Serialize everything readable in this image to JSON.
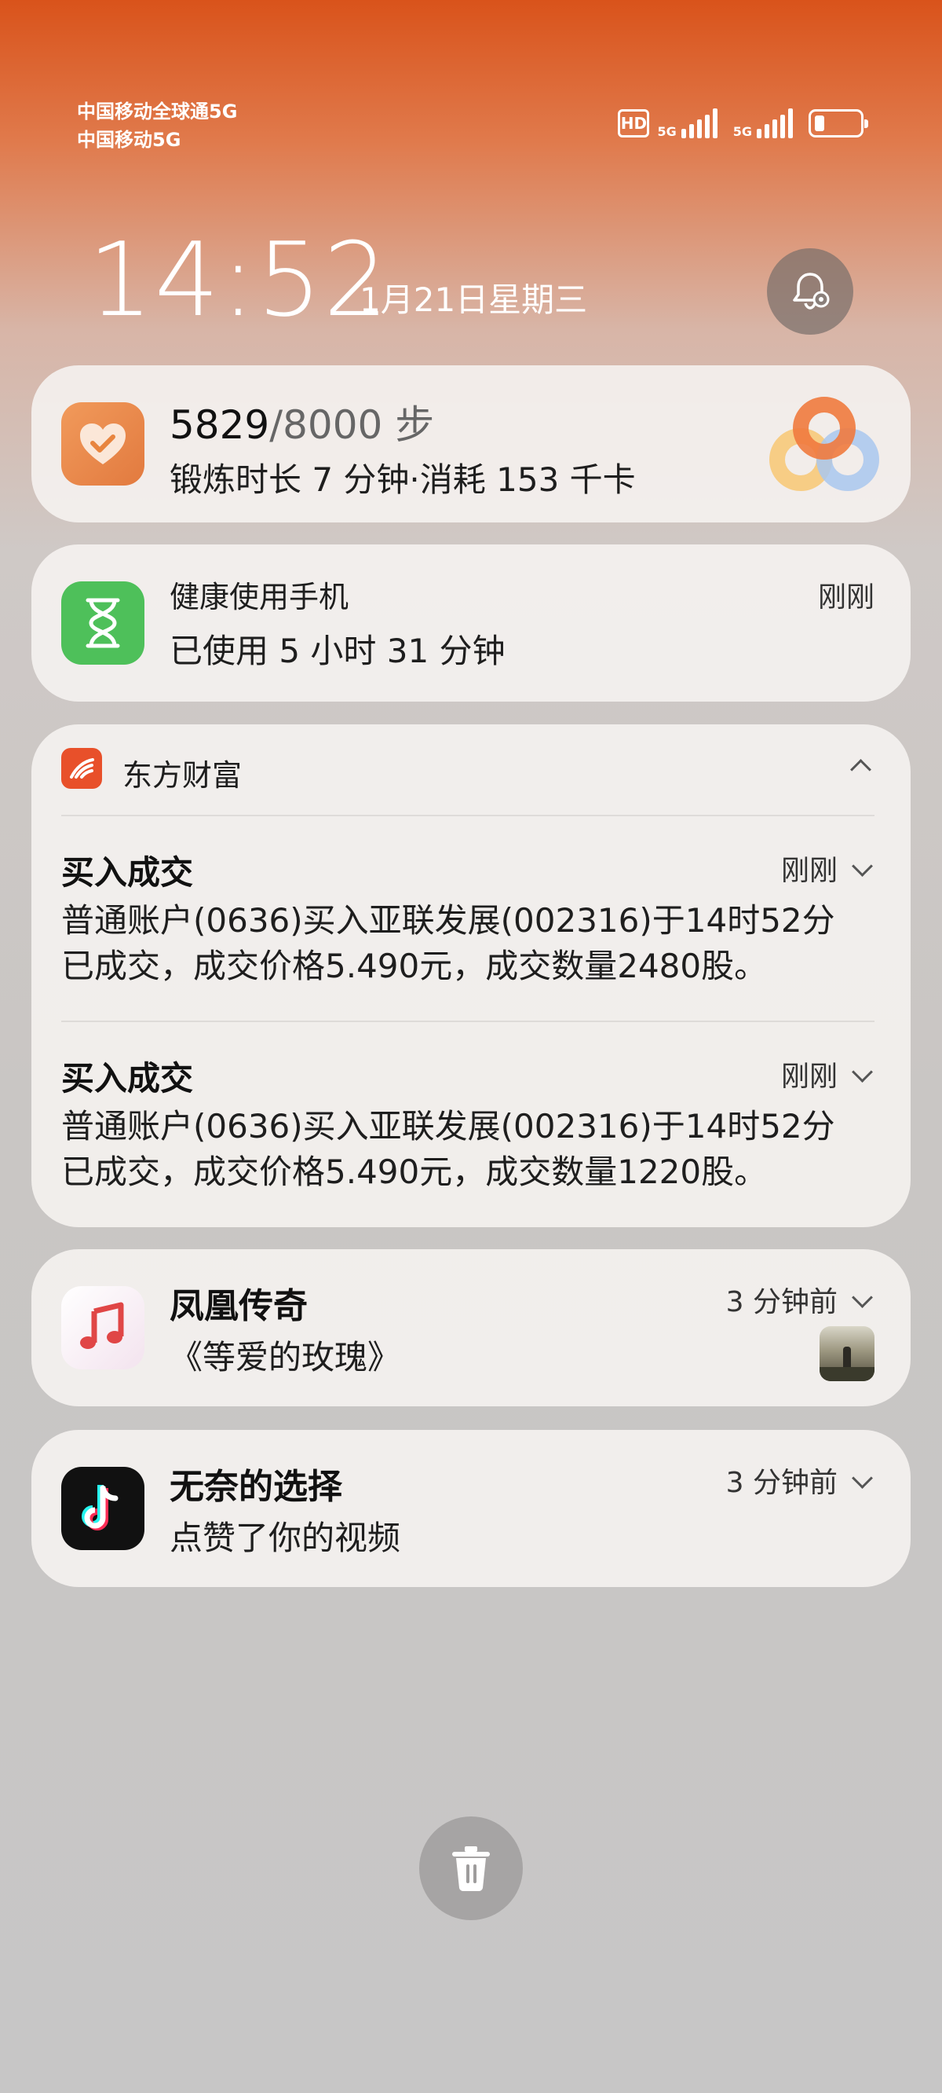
{
  "status_bar": {
    "carrier1": "中国移动全球通5G",
    "carrier2": "中国移动5G",
    "hd": "HD",
    "sig1_label": "5G",
    "sig2_label": "5G",
    "battery_level": 0.22
  },
  "lockscreen": {
    "time": "14:52",
    "date": "1月21日星期三"
  },
  "health_card": {
    "steps": "5829",
    "goal": "/8000 步",
    "detail": "锻炼时长 7 分钟·消耗 153 千卡"
  },
  "screen_time_card": {
    "title": "健康使用手机",
    "time": "刚刚",
    "body": "已使用 5 小时 31 分钟"
  },
  "finance_group": {
    "app_name": "东方财富",
    "items": [
      {
        "title": "买入成交",
        "time": "刚刚",
        "line1": "普通账户(0636)买入亚联发展(002316)于14时52分",
        "line2": "已成交，成交价格5.490元，成交数量2480股。"
      },
      {
        "title": "买入成交",
        "time": "刚刚",
        "line1": "普通账户(0636)买入亚联发展(002316)于14时52分",
        "line2": "已成交，成交价格5.490元，成交数量1220股。"
      }
    ]
  },
  "music_card": {
    "title": "凤凰传奇",
    "time": "3 分钟前",
    "body": "《等爱的玫瑰》"
  },
  "douyin_card": {
    "title": "无奈的选择",
    "time": "3 分钟前",
    "body": "点赞了你的视频"
  },
  "colors": {
    "health_orange": "#ec8a52",
    "screen_green": "#4ec05a",
    "finance_red": "#e8502a",
    "music_red": "#e04646",
    "douyin_black": "#111111"
  }
}
